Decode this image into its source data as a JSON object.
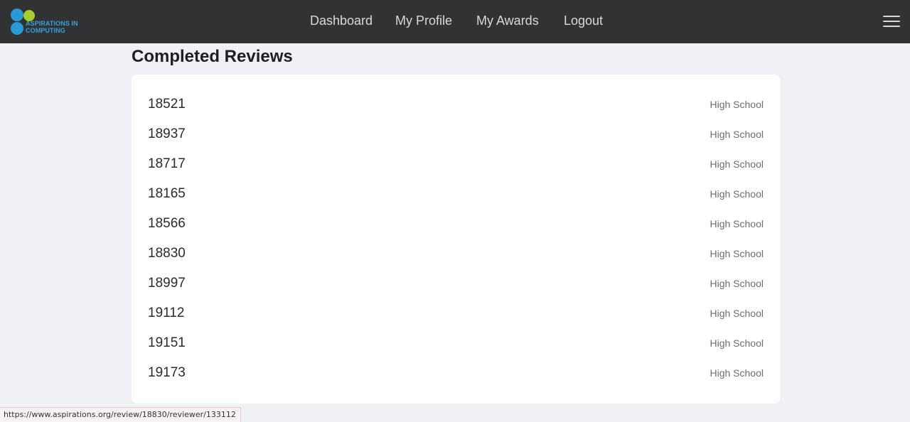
{
  "brand": {
    "logo_text_line1": "ASPIRATIONS IN",
    "logo_text_line2": "COMPUTING",
    "colors": {
      "blue": "#2a9ad6",
      "green": "#a6cc2e"
    }
  },
  "nav": {
    "items": [
      {
        "label": "Dashboard"
      },
      {
        "label": "My Profile"
      },
      {
        "label": "My Awards"
      },
      {
        "label": "Logout"
      }
    ],
    "menu_icon": "hamburger-menu-icon"
  },
  "page": {
    "title": "Completed Reviews"
  },
  "reviews": [
    {
      "id": "18521",
      "level": "High School"
    },
    {
      "id": "18937",
      "level": "High School"
    },
    {
      "id": "18717",
      "level": "High School"
    },
    {
      "id": "18165",
      "level": "High School"
    },
    {
      "id": "18566",
      "level": "High School"
    },
    {
      "id": "18830",
      "level": "High School"
    },
    {
      "id": "18997",
      "level": "High School"
    },
    {
      "id": "19112",
      "level": "High School"
    },
    {
      "id": "19151",
      "level": "High School"
    },
    {
      "id": "19173",
      "level": "High School"
    }
  ],
  "status_bar": {
    "url": "https://www.aspirations.org/review/18830/reviewer/133112"
  }
}
